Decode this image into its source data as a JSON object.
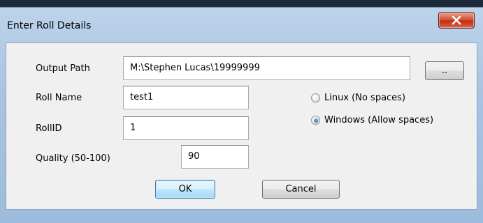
{
  "window": {
    "title": "Enter Roll Details"
  },
  "form": {
    "output_path_label": "Output Path",
    "output_path_value": "M:\\Stephen Lucas\\19999999",
    "browse_label": "..",
    "roll_name_label": "Roll Name",
    "roll_name_value": "test1",
    "roll_id_label": "RollID",
    "roll_id_value": "1",
    "quality_label": "Quality (50-100)",
    "quality_value": "90"
  },
  "os_options": [
    {
      "label": "Linux (No spaces)",
      "selected": false
    },
    {
      "label": "Windows (Allow spaces)",
      "selected": true
    }
  ],
  "buttons": {
    "ok_label": "OK",
    "cancel_label": "Cancel"
  },
  "colors": {
    "close_button": "#c8381c",
    "focus_accent": "#3c7fb1"
  }
}
